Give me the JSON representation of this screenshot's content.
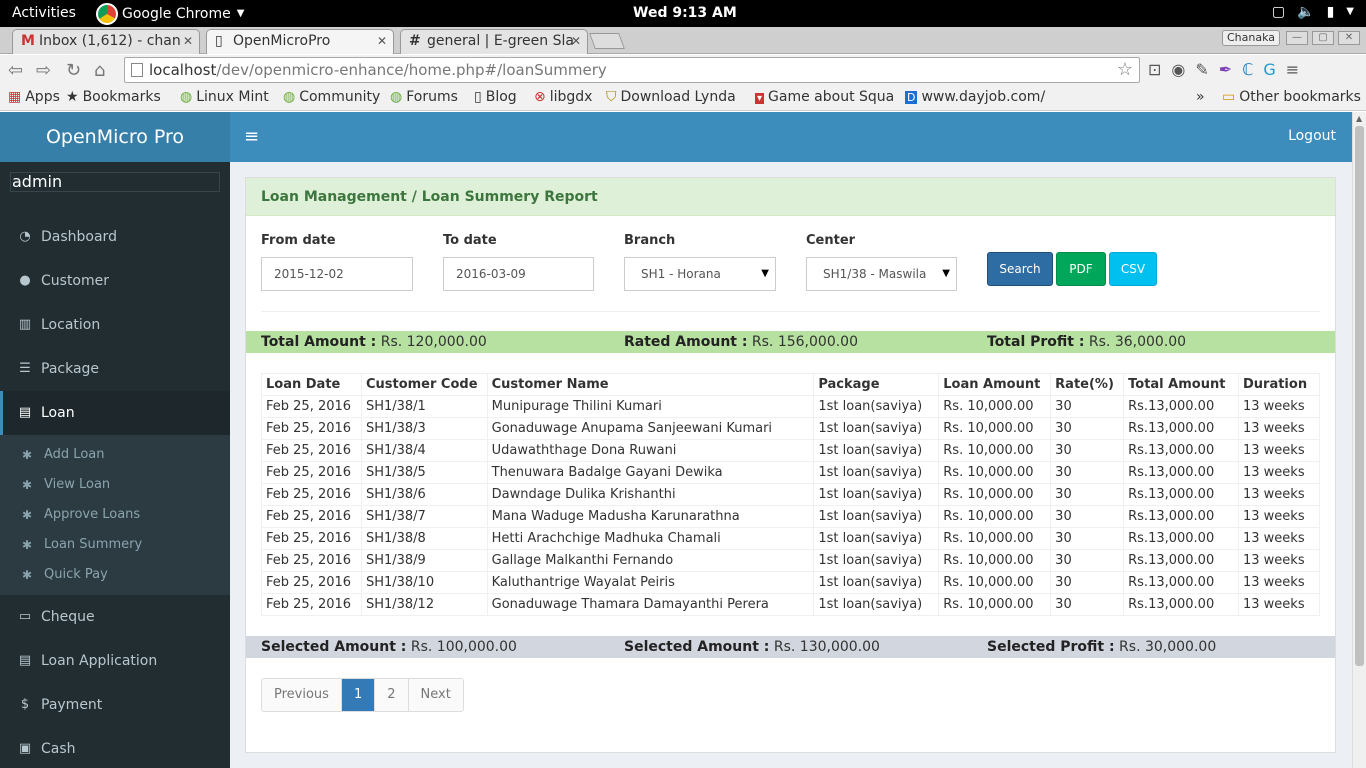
{
  "os": {
    "activities": "Activities",
    "app_name": "Google Chrome",
    "clock": "Wed  9:13 AM"
  },
  "browser": {
    "tabs": [
      {
        "label": "Inbox (1,612) - chan"
      },
      {
        "label": "OpenMicroPro"
      },
      {
        "label": "general | E-green Sla"
      }
    ],
    "profile": "Chanaka",
    "url_host": "localhost",
    "url_path": "/dev/openmicro-enhance/home.php#/loanSummery",
    "bookmarks": [
      {
        "label": "Apps"
      },
      {
        "label": "Bookmarks"
      },
      {
        "label": "Linux Mint"
      },
      {
        "label": "Community"
      },
      {
        "label": "Forums"
      },
      {
        "label": "Blog"
      },
      {
        "label": "libgdx"
      },
      {
        "label": "Download Lynda"
      },
      {
        "label": "Game about Squa"
      },
      {
        "label": "www.dayjob.com/"
      }
    ],
    "more_bookmarks": "»",
    "other_bookmarks": "Other bookmarks"
  },
  "app": {
    "brand": "OpenMicro Pro",
    "user": "admin",
    "logout": "Logout",
    "menu": [
      {
        "label": "Dashboard",
        "icon": "dashboard-icon"
      },
      {
        "label": "Customer",
        "icon": "user-icon"
      },
      {
        "label": "Location",
        "icon": "map-icon"
      },
      {
        "label": "Package",
        "icon": "list-icon"
      },
      {
        "label": "Loan",
        "icon": "loan-icon"
      },
      {
        "label": "Cheque",
        "icon": "cheque-icon"
      },
      {
        "label": "Loan Application",
        "icon": "application-icon"
      },
      {
        "label": "Payment",
        "icon": "dollar-icon"
      },
      {
        "label": "Cash",
        "icon": "cash-icon"
      }
    ],
    "submenu": [
      {
        "label": "Add Loan"
      },
      {
        "label": "View Loan"
      },
      {
        "label": "Approve Loans"
      },
      {
        "label": "Loan Summery"
      },
      {
        "label": "Quick Pay"
      }
    ]
  },
  "report": {
    "title": "Loan Management / Loan Summery Report",
    "filters": {
      "from_label": "From date",
      "from_value": "2015-12-02",
      "to_label": "To date",
      "to_value": "2016-03-09",
      "branch_label": "Branch",
      "branch_value": "SH1 - Horana",
      "center_label": "Center",
      "center_value": "SH1/38 - Maswila"
    },
    "buttons": {
      "search": "Search",
      "pdf": "PDF",
      "csv": "CSV"
    },
    "totals": {
      "total_amount_label": "Total Amount :",
      "total_amount": "Rs. 120,000.00",
      "rated_amount_label": "Rated Amount :",
      "rated_amount": "Rs. 156,000.00",
      "total_profit_label": "Total Profit :",
      "total_profit": "Rs. 36,000.00"
    },
    "selected": {
      "selected_amount_label": "Selected Amount :",
      "selected_amount": "Rs. 100,000.00",
      "selected_rated_label": "Selected Amount :",
      "selected_rated": "Rs. 130,000.00",
      "selected_profit_label": "Selected Profit :",
      "selected_profit": "Rs. 30,000.00"
    },
    "columns": [
      "Loan Date",
      "Customer Code",
      "Customer Name",
      "Package",
      "Loan Amount",
      "Rate(%)",
      "Total Amount",
      "Duration"
    ],
    "rows": [
      [
        "Feb 25, 2016",
        "SH1/38/1",
        "Munipurage Thilini Kumari",
        "1st loan(saviya)",
        "Rs. 10,000.00",
        "30",
        "Rs.13,000.00",
        "13 weeks"
      ],
      [
        "Feb 25, 2016",
        "SH1/38/3",
        "Gonaduwage Anupama Sanjeewani Kumari",
        "1st loan(saviya)",
        "Rs. 10,000.00",
        "30",
        "Rs.13,000.00",
        "13 weeks"
      ],
      [
        "Feb 25, 2016",
        "SH1/38/4",
        "Udawaththage Dona Ruwani",
        "1st loan(saviya)",
        "Rs. 10,000.00",
        "30",
        "Rs.13,000.00",
        "13 weeks"
      ],
      [
        "Feb 25, 2016",
        "SH1/38/5",
        "Thenuwara Badalge Gayani Dewika",
        "1st loan(saviya)",
        "Rs. 10,000.00",
        "30",
        "Rs.13,000.00",
        "13 weeks"
      ],
      [
        "Feb 25, 2016",
        "SH1/38/6",
        "Dawndage Dulika Krishanthi",
        "1st loan(saviya)",
        "Rs. 10,000.00",
        "30",
        "Rs.13,000.00",
        "13 weeks"
      ],
      [
        "Feb 25, 2016",
        "SH1/38/7",
        "Mana Waduge Madusha Karunarathna",
        "1st loan(saviya)",
        "Rs. 10,000.00",
        "30",
        "Rs.13,000.00",
        "13 weeks"
      ],
      [
        "Feb 25, 2016",
        "SH1/38/8",
        "Hetti Arachchige Madhuka Chamali",
        "1st loan(saviya)",
        "Rs. 10,000.00",
        "30",
        "Rs.13,000.00",
        "13 weeks"
      ],
      [
        "Feb 25, 2016",
        "SH1/38/9",
        "Gallage Malkanthi Fernando",
        "1st loan(saviya)",
        "Rs. 10,000.00",
        "30",
        "Rs.13,000.00",
        "13 weeks"
      ],
      [
        "Feb 25, 2016",
        "SH1/38/10",
        "Kaluthantrige Wayalat Peiris",
        "1st loan(saviya)",
        "Rs. 10,000.00",
        "30",
        "Rs.13,000.00",
        "13 weeks"
      ],
      [
        "Feb 25, 2016",
        "SH1/38/12",
        "Gonaduwage Thamara Damayanthi Perera",
        "1st loan(saviya)",
        "Rs. 10,000.00",
        "30",
        "Rs.13,000.00",
        "13 weeks"
      ]
    ],
    "pagination": {
      "previous": "Previous",
      "pages": [
        "1",
        "2"
      ],
      "current": "1",
      "next": "Next"
    }
  },
  "colors": {
    "header_blue": "#3c8dbc",
    "brand_blue": "#367fa9",
    "sidebar_dark": "#222d32",
    "success_green": "#00a65a",
    "info_cyan": "#00c0ef",
    "totals_green": "#b7e1a1"
  }
}
